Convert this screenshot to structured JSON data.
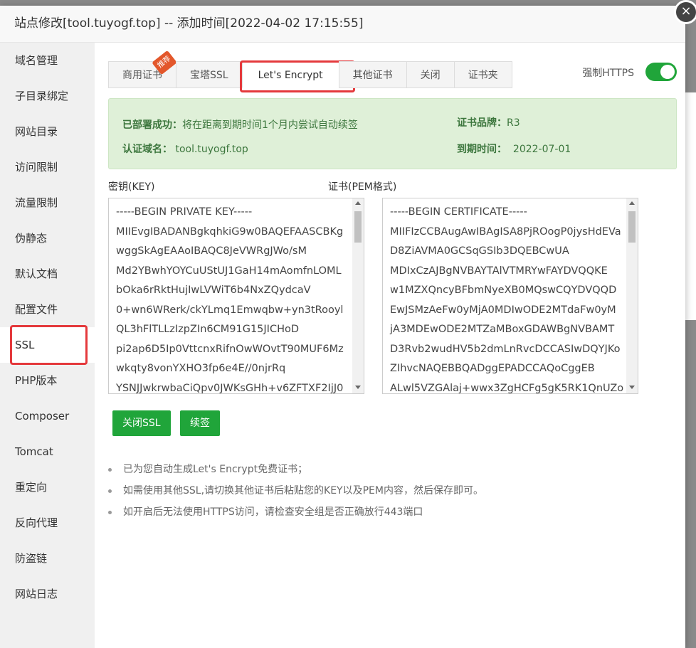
{
  "dialog": {
    "title": "站点修改[tool.tuyogf.top] -- 添加时间[2022-04-02 17:15:55]",
    "close_glyph": "×"
  },
  "sidebar": {
    "items": [
      {
        "label": "域名管理"
      },
      {
        "label": "子目录绑定"
      },
      {
        "label": "网站目录"
      },
      {
        "label": "访问限制"
      },
      {
        "label": "流量限制"
      },
      {
        "label": "伪静态"
      },
      {
        "label": "默认文档"
      },
      {
        "label": "配置文件"
      },
      {
        "label": "SSL"
      },
      {
        "label": "PHP版本"
      },
      {
        "label": "Composer"
      },
      {
        "label": "Tomcat"
      },
      {
        "label": "重定向"
      },
      {
        "label": "反向代理"
      },
      {
        "label": "防盗链"
      },
      {
        "label": "网站日志"
      }
    ],
    "active_index": 8
  },
  "tabs": {
    "items": [
      {
        "label": "商用证书",
        "badge": "推荐"
      },
      {
        "label": "宝塔SSL"
      },
      {
        "label": "Let's Encrypt"
      },
      {
        "label": "其他证书"
      },
      {
        "label": "关闭"
      },
      {
        "label": "证书夹"
      }
    ],
    "active_index": 2
  },
  "force_https": {
    "label": "强制HTTPS",
    "enabled": true
  },
  "status": {
    "deploy_label": "已部署成功：",
    "deploy_text": "将在距离到期时间1个月内尝试自动续签",
    "domain_label": "认证域名：",
    "domain_value": "tool.tuyogf.top",
    "brand_label": "证书品牌：",
    "brand_value": "R3",
    "expiry_label": "到期时间：",
    "expiry_value": "2022-07-01"
  },
  "key_panel": {
    "label": "密钥(KEY)",
    "lines": [
      "-----BEGIN PRIVATE KEY-----",
      "MIIEvgIBADANBgkqhkiG9w0BAQEFAASCBKg",
      "wggSkAgEAAoIBAQC8JeVWRgJWo/sM",
      "Md2YBwhYOYCuUStUJ1GaH14mAomfnLOML",
      "bOka6rRktHujIwLVWiT6b4NxZQydcaV",
      "0+wn6WRerk/ckYLmq1Emwqbw+yn3tRooyl",
      "QL3hFlTLLzIzpZIn6CM91G15JICHoD",
      "pi2ap6D5Ip0VttcnxRifnOwWOvtT90MUF6Mz",
      "wkqty8vonYXHO3fp6e4E//0njrRq",
      "YSNJJwkrwbaCiQpv0JWKsGHh+v6ZFTXF2IjJ0"
    ]
  },
  "cert_panel": {
    "label": "证书(PEM格式)",
    "lines": [
      "-----BEGIN CERTIFICATE-----",
      "MIIFIzCCBAugAwIBAgISA8PjROogP0jysHdEVa",
      "D8ZiAVMA0GCSqGSIb3DQEBCwUA",
      "MDIxCzAJBgNVBAYTAlVTMRYwFAYDVQQKE",
      "w1MZXQncyBFbmNyeXB0MQswCQYDVQQD",
      "EwJSMzAeFw0yMjA0MDIwODE2MTdaFw0yM",
      "jA3MDEwODE2MTZaMBoxGDAWBgNVBAMT",
      "D3Rvb2wudHV5b2dmLnRvcDCCASIwDQYJKo",
      "ZIhvcNAQEBBQADggEPADCCAQoCggEB",
      "ALwl5VZGAlaj+wwx3ZgHCFg5gK5RK1QnUZo"
    ]
  },
  "buttons": {
    "close_ssl": "关闭SSL",
    "renew": "续签"
  },
  "tips": [
    "已为您自动生成Let's Encrypt免费证书；",
    "如需使用其他SSL,请切换其他证书后粘贴您的KEY以及PEM内容，然后保存即可。",
    "如开启后无法使用HTTPS访问，请检查安全组是否正确放行443端口"
  ]
}
